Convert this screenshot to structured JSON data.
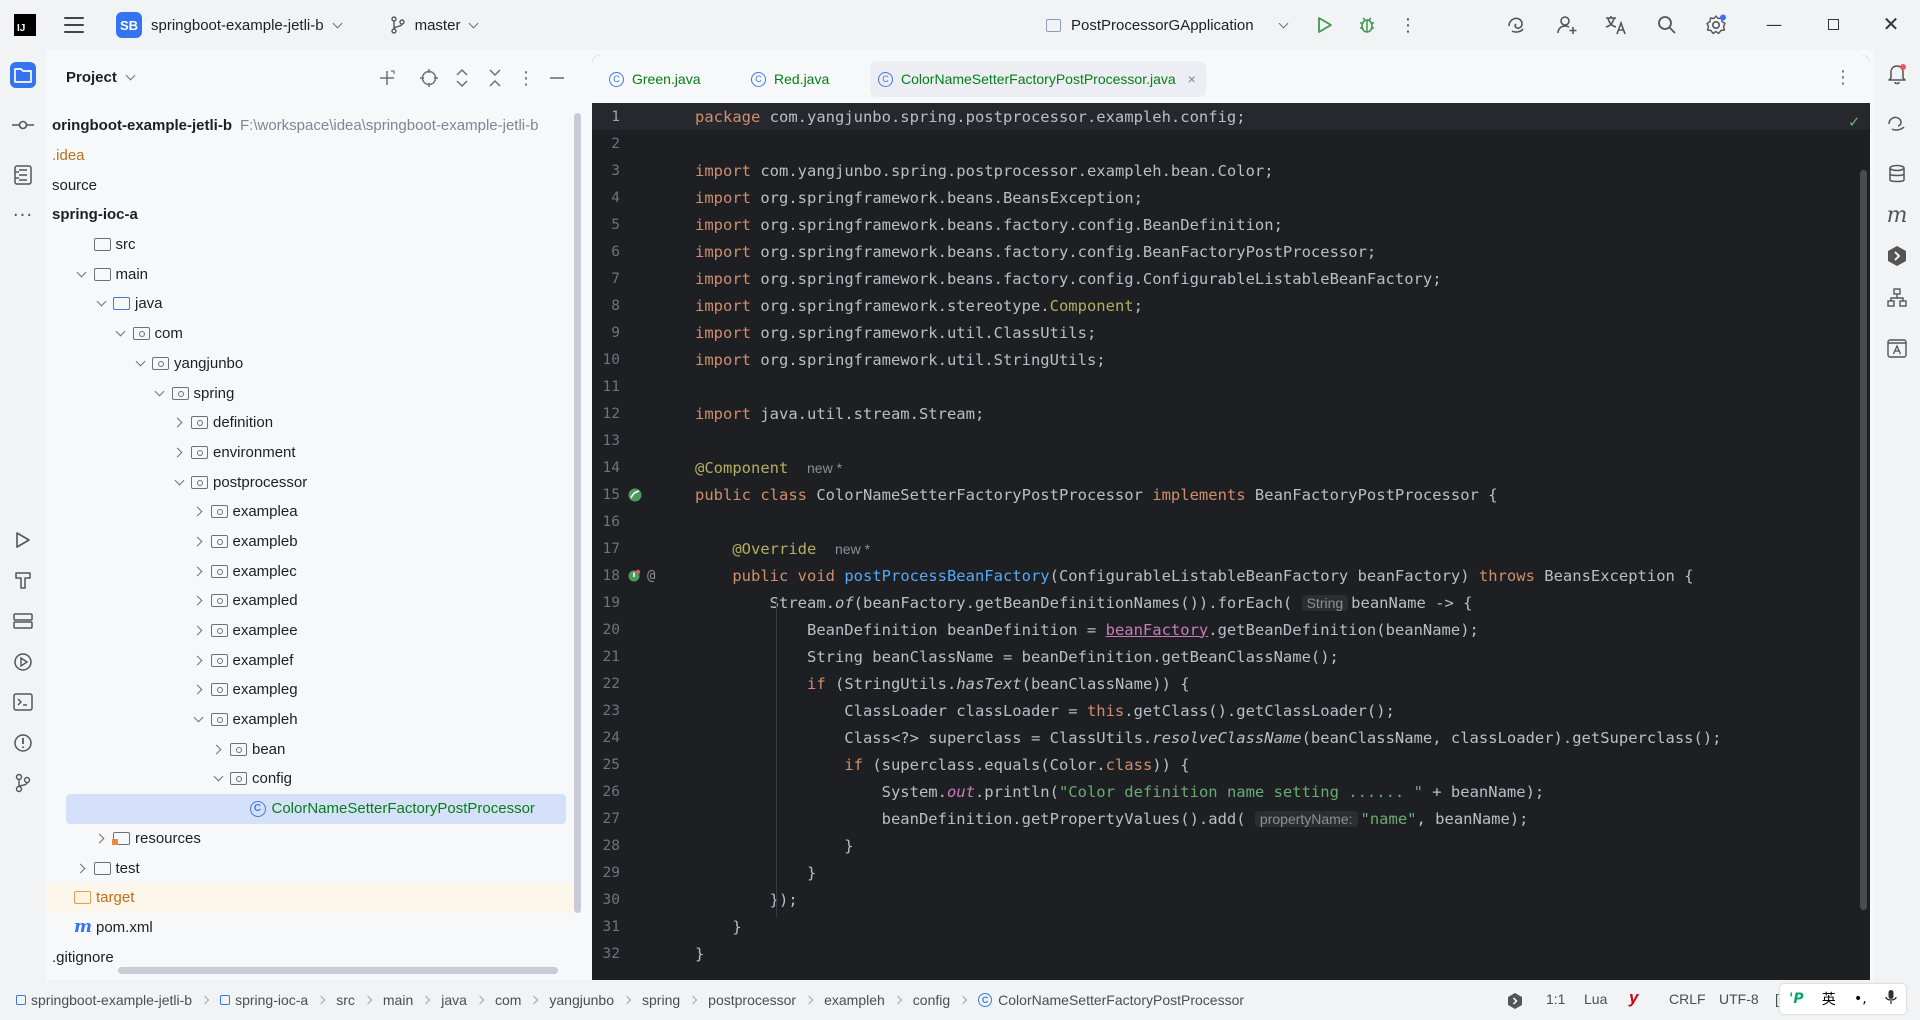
{
  "titlebar": {
    "logo_text": "IJ",
    "project_badge": "SB",
    "project_name": "springboot-example-jetli-b",
    "branch": "master",
    "run_config": "PostProcessorGApplication"
  },
  "project_panel": {
    "title": "Project",
    "tree": [
      {
        "label": "oringboot-example-jetli-b",
        "path": "F:\\workspace\\idea\\springboot-example-jetli-b",
        "indent": 0,
        "arrow": "none",
        "icon": "none",
        "style": "bold"
      },
      {
        "label": ".idea",
        "indent": 0,
        "arrow": "none",
        "icon": "none",
        "style": "brown"
      },
      {
        "label": "source",
        "indent": 0,
        "arrow": "none",
        "icon": "none",
        "style": "normal"
      },
      {
        "label": "spring-ioc-a",
        "indent": 0,
        "arrow": "none",
        "icon": "none",
        "style": "bold"
      },
      {
        "label": "src",
        "indent": 1,
        "arrow": "none",
        "icon": "folder",
        "style": "normal"
      },
      {
        "label": "main",
        "indent": 1,
        "arrow": "down",
        "icon": "folder",
        "style": "normal"
      },
      {
        "label": "java",
        "indent": 2,
        "arrow": "down",
        "icon": "folder-blue",
        "style": "normal"
      },
      {
        "label": "com",
        "indent": 3,
        "arrow": "down",
        "icon": "package",
        "style": "normal"
      },
      {
        "label": "yangjunbo",
        "indent": 4,
        "arrow": "down",
        "icon": "package",
        "style": "normal"
      },
      {
        "label": "spring",
        "indent": 5,
        "arrow": "down",
        "icon": "package",
        "style": "normal"
      },
      {
        "label": "definition",
        "indent": 6,
        "arrow": "right",
        "icon": "package",
        "style": "normal"
      },
      {
        "label": "environment",
        "indent": 6,
        "arrow": "right",
        "icon": "package",
        "style": "normal"
      },
      {
        "label": "postprocessor",
        "indent": 6,
        "arrow": "down",
        "icon": "package",
        "style": "normal"
      },
      {
        "label": "examplea",
        "indent": 7,
        "arrow": "right",
        "icon": "package",
        "style": "normal"
      },
      {
        "label": "exampleb",
        "indent": 7,
        "arrow": "right",
        "icon": "package",
        "style": "normal"
      },
      {
        "label": "examplec",
        "indent": 7,
        "arrow": "right",
        "icon": "package",
        "style": "normal"
      },
      {
        "label": "exampled",
        "indent": 7,
        "arrow": "right",
        "icon": "package",
        "style": "normal"
      },
      {
        "label": "examplee",
        "indent": 7,
        "arrow": "right",
        "icon": "package",
        "style": "normal"
      },
      {
        "label": "examplef",
        "indent": 7,
        "arrow": "right",
        "icon": "package",
        "style": "normal"
      },
      {
        "label": "exampleg",
        "indent": 7,
        "arrow": "right",
        "icon": "package",
        "style": "normal"
      },
      {
        "label": "exampleh",
        "indent": 7,
        "arrow": "down",
        "icon": "package",
        "style": "normal"
      },
      {
        "label": "bean",
        "indent": 8,
        "arrow": "right",
        "icon": "package",
        "style": "normal"
      },
      {
        "label": "config",
        "indent": 8,
        "arrow": "down",
        "icon": "package",
        "style": "normal"
      },
      {
        "label": "ColorNameSetterFactoryPostProcessor",
        "indent": 9,
        "arrow": "none",
        "icon": "class",
        "style": "green",
        "selected": true
      },
      {
        "label": "resources",
        "indent": 2,
        "arrow": "right",
        "icon": "resources",
        "style": "normal"
      },
      {
        "label": "test",
        "indent": 1,
        "arrow": "right",
        "icon": "folder",
        "style": "normal"
      },
      {
        "label": "target",
        "indent": 0,
        "arrow": "none",
        "icon": "folder-orange",
        "style": "brown",
        "highlight": true
      },
      {
        "label": "pom.xml",
        "indent": 0,
        "arrow": "none",
        "icon": "maven",
        "style": "normal"
      },
      {
        "label": ".gitignore",
        "indent": 0,
        "arrow": "none",
        "icon": "none",
        "style": "normal"
      }
    ]
  },
  "editor": {
    "tabs": [
      {
        "label": "Green.java",
        "active": false
      },
      {
        "label": "Red.java",
        "active": false
      },
      {
        "label": "ColorNameSetterFactoryPostProcessor.java",
        "active": true
      }
    ],
    "close_glyph": "×",
    "inlay_new": "new *",
    "inlay_string": "String",
    "inlay_property": "propertyName:"
  },
  "status": {
    "breadcrumbs": [
      "springboot-example-jetli-b",
      "spring-ioc-a",
      "src",
      "main",
      "java",
      "com",
      "yangjunbo",
      "spring",
      "postprocessor",
      "exampleh",
      "config",
      "ColorNameSetterFactoryPostProcessor"
    ],
    "position": "1:1",
    "language": "Lua",
    "line_sep": "CRLF",
    "encoding": "UTF-8",
    "ime_lang": "英",
    "ime_punct": "•,"
  }
}
